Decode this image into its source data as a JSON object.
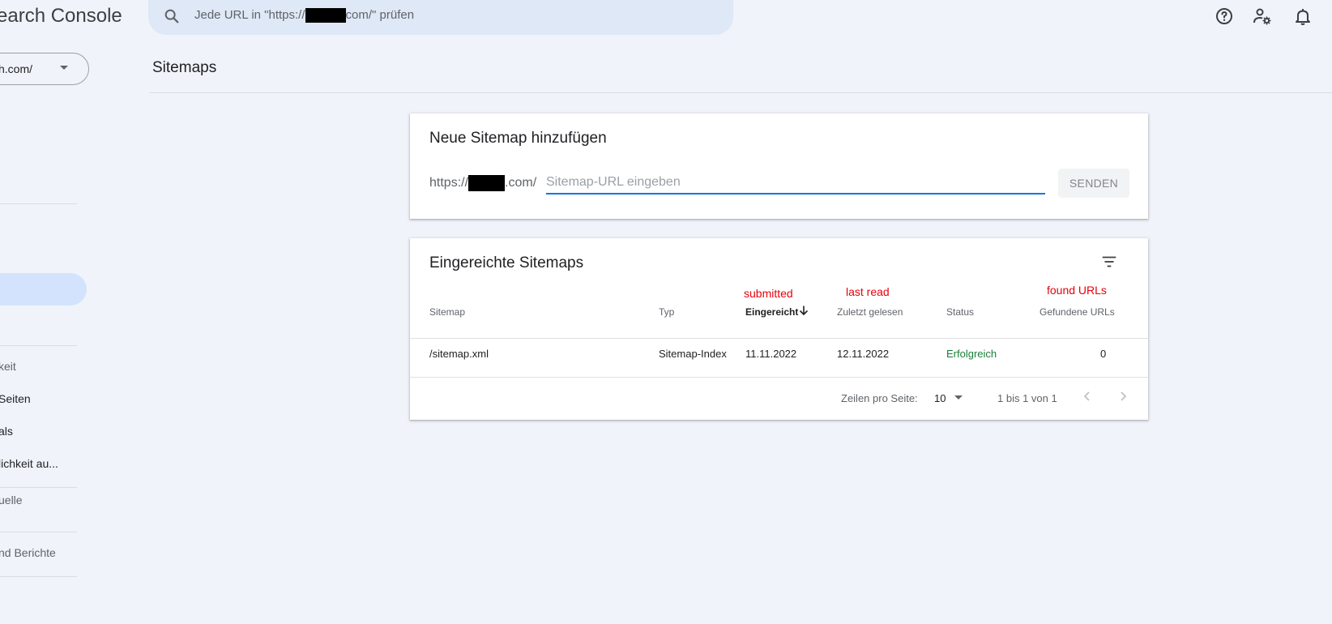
{
  "app": {
    "title": "earch Console"
  },
  "search": {
    "placeholder_pre": "Jede URL in \"https://",
    "placeholder_post": "com/\" prüfen"
  },
  "property": {
    "label": "h.com/"
  },
  "sidebar": {
    "items": [
      {
        "label": "keit",
        "color": "#5f6368"
      },
      {
        "label": " Seiten",
        "color": "#202124"
      },
      {
        "label": "als",
        "color": "#202124"
      },
      {
        "label": "lichkeit au...",
        "color": "#202124"
      },
      {
        "label": "uelle",
        "color": "#5f6368"
      },
      {
        "label": "nd Berichte",
        "color": "#5f6368"
      }
    ]
  },
  "page": {
    "title": "Sitemaps"
  },
  "add_sitemap": {
    "title": "Neue Sitemap hinzufügen",
    "url_prefix_pre": "https://",
    "url_prefix_post": ".com/",
    "input_placeholder": "Sitemap-URL eingeben",
    "send_label": "SENDEN"
  },
  "submitted": {
    "title": "Eingereichte Sitemaps",
    "annotations": {
      "submitted": "submitted",
      "last_read": "last read",
      "found_urls": "found URLs"
    },
    "columns": {
      "sitemap": "Sitemap",
      "type": "Typ",
      "submitted": "Eingereicht",
      "last_read": "Zuletzt gelesen",
      "status": "Status",
      "found_urls": "Gefundene URLs"
    },
    "rows": [
      {
        "sitemap": "/sitemap.xml",
        "type": "Sitemap-Index",
        "submitted": "11.11.2022",
        "last_read": "12.11.2022",
        "status": "Erfolgreich",
        "found_urls": "0"
      }
    ],
    "footer": {
      "rows_per_page_label": "Zeilen pro Seite:",
      "rows_per_page_value": "10",
      "range": "1 bis 1 von 1"
    }
  },
  "colors": {
    "accent": "#1a73e8",
    "success": "#188038",
    "annotation": "#e8000b",
    "nav_active": "#d3e3fd"
  }
}
